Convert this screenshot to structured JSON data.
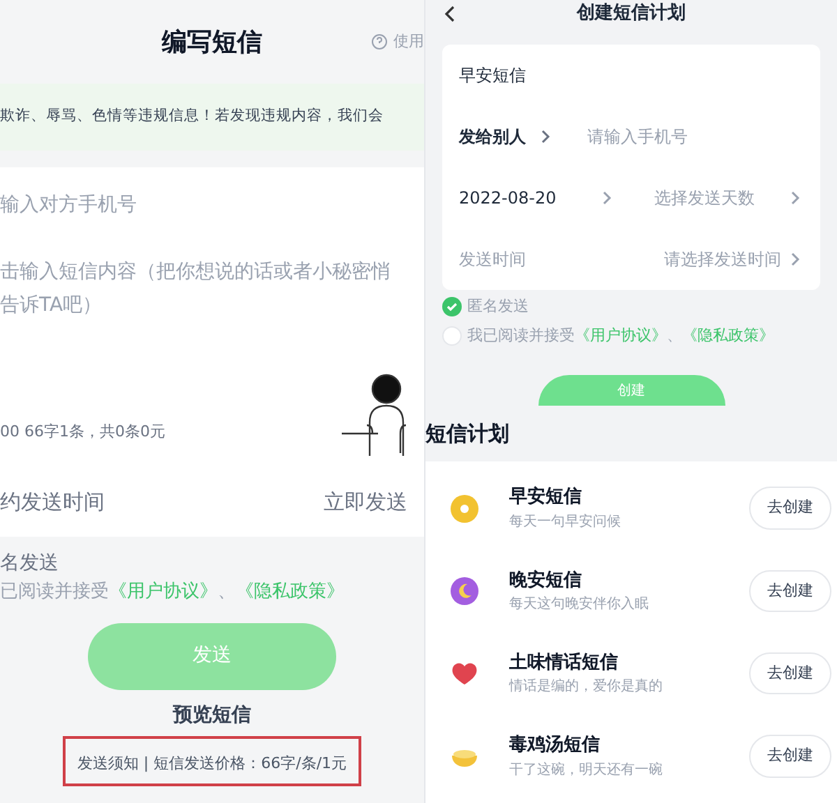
{
  "compose": {
    "title": "编写短信",
    "help_label": "使用",
    "notice": "欺诈、辱骂、色情等违规信息！若发现违规内容，我们会",
    "phone_placeholder": "输入对方手机号",
    "content_placeholder": [
      "击输入短信内容（把你想说的话或者小秘密悄",
      "告诉TA吧）"
    ],
    "counter": "00 66字1条，共0条0元",
    "schedule_label": "约发送时间",
    "send_now": "立即发送",
    "anonymous_label": "名发送",
    "agreement": {
      "prefix": "已阅读并接受",
      "link_1": "《用户协议》",
      "separator": "、",
      "link_2": "《隐私政策》"
    },
    "send_button": "发送",
    "preview_label": "预览短信",
    "price_note": "发送须知 | 短信发送价格：66字/条/1元"
  },
  "create_plan": {
    "title": "创建短信计划",
    "plan_name": "早安短信",
    "recipient_label": "发给别人",
    "recipient_placeholder": "请输入手机号",
    "start_date": "2022-08-20",
    "days_placeholder": "选择发送天数",
    "time_label": "发送时间",
    "time_placeholder": "请选择发送时间",
    "options": [
      {
        "label": "匿名发送",
        "checked": true
      },
      {
        "label": "我已阅读并接受",
        "link_1": "《用户协议》",
        "separator": "、",
        "link_2": "《隐私政策》",
        "checked": false
      }
    ],
    "create_button": "创建"
  },
  "plans": {
    "title": "短信计划",
    "items": [
      {
        "kind": "sun",
        "color": "#f2c230",
        "title": "早安短信",
        "subtitle": "每天一句早安问候",
        "button": "去创建"
      },
      {
        "kind": "moon",
        "color": "#a35ee0",
        "title": "晚安短信",
        "subtitle": "每天这句晚安伴你入眠",
        "button": "去创建"
      },
      {
        "kind": "heart",
        "color": "#e0444f",
        "title": "土味情话短信",
        "subtitle": "情话是编的，爱你是真的",
        "button": "去创建"
      },
      {
        "kind": "bowl",
        "color": "#f3c23a",
        "title": "毒鸡汤短信",
        "subtitle": "干了这碗，明天还有一碗",
        "button": "去创建"
      }
    ]
  }
}
